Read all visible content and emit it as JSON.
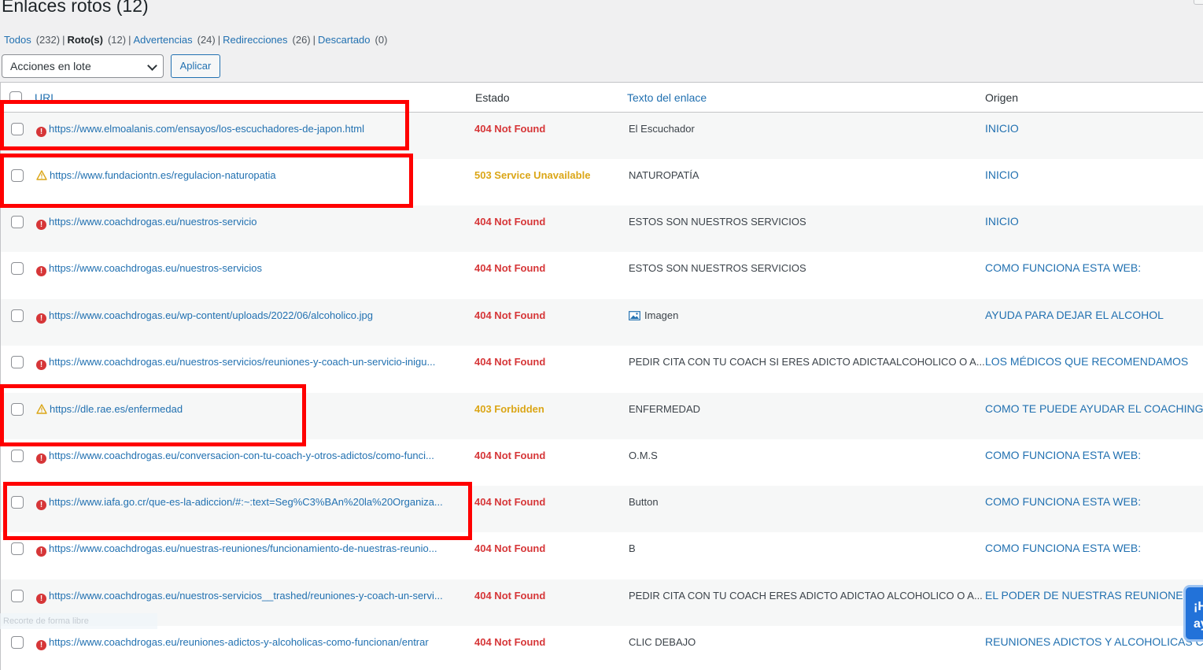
{
  "header": {
    "title": "Enlaces rotos (12)"
  },
  "filters": [
    {
      "label": "Todos",
      "count": "(232)",
      "current": false
    },
    {
      "label": "Roto(s)",
      "count": "(12)",
      "current": true
    },
    {
      "label": "Advertencias",
      "count": "(24)",
      "current": false
    },
    {
      "label": "Redirecciones",
      "count": "(26)",
      "current": false
    },
    {
      "label": "Descartado",
      "count": "(0)",
      "current": false
    }
  ],
  "bulk": {
    "select_value": "Acciones en lote",
    "apply_label": "Aplicar"
  },
  "table": {
    "columns": {
      "url": "URL",
      "estado": "Estado",
      "texto": "Texto del enlace",
      "origen": "Origen"
    },
    "rows": [
      {
        "icon": "error-icon",
        "url": "https://www.elmoalanis.com/ensayos/los-escuchadores-de-japon.html",
        "estado": "404 Not Found",
        "estado_type": "error",
        "texto": "El Escuchador",
        "texto_icon": "",
        "origen": "INICIO"
      },
      {
        "icon": "warning-icon",
        "url": "https://www.fundaciontn.es/regulacion-naturopatia",
        "estado": "503 Service Unavailable",
        "estado_type": "warning",
        "texto": "NATUROPATÍA",
        "texto_icon": "",
        "origen": "INICIO"
      },
      {
        "icon": "error-icon",
        "url": "https://www.coachdrogas.eu/nuestros-servicio",
        "estado": "404 Not Found",
        "estado_type": "error",
        "texto": "ESTOS SON NUESTROS SERVICIOS",
        "texto_icon": "",
        "origen": "INICIO"
      },
      {
        "icon": "error-icon",
        "url": "https://www.coachdrogas.eu/nuestros-servicios",
        "estado": "404 Not Found",
        "estado_type": "error",
        "texto": "ESTOS SON NUESTROS SERVICIOS",
        "texto_icon": "",
        "origen": "COMO FUNCIONA ESTA WEB:"
      },
      {
        "icon": "error-icon",
        "url": "https://www.coachdrogas.eu/wp-content/uploads/2022/06/alcoholico.jpg",
        "estado": "404 Not Found",
        "estado_type": "error",
        "texto": "Imagen",
        "texto_icon": "image-icon",
        "origen": "AYUDA PARA DEJAR EL ALCOHOL"
      },
      {
        "icon": "error-icon",
        "url": "https://www.coachdrogas.eu/nuestros-servicios/reuniones-y-coach-un-servicio-inigu...",
        "estado": "404 Not Found",
        "estado_type": "error",
        "texto": "PEDIR CITA CON TU COACH SI ERES ADICTO ADICTAALCOHOLICO O A...",
        "texto_icon": "",
        "origen": "LOS MÉDICOS QUE RECOMENDAMOS"
      },
      {
        "icon": "warning-icon",
        "url": "https://dle.rae.es/enfermedad",
        "estado": "403 Forbidden",
        "estado_type": "warning",
        "texto": "ENFERMEDAD",
        "texto_icon": "",
        "origen": "COMO TE PUEDE AYUDAR EL COACHING A"
      },
      {
        "icon": "error-icon",
        "url": "https://www.coachdrogas.eu/conversacion-con-tu-coach-y-otros-adictos/como-funci...",
        "estado": "404 Not Found",
        "estado_type": "error",
        "texto": "O.M.S",
        "texto_icon": "",
        "origen": "COMO FUNCIONA ESTA WEB:"
      },
      {
        "icon": "error-icon",
        "url": "https://www.iafa.go.cr/que-es-la-adiccion/#:~:text=Seg%C3%BAn%20la%20Organiza...",
        "estado": "404 Not Found",
        "estado_type": "error",
        "texto": "Button",
        "texto_icon": "",
        "origen": "COMO FUNCIONA ESTA WEB:"
      },
      {
        "icon": "error-icon",
        "url": "https://www.coachdrogas.eu/nuestras-reuniones/funcionamiento-de-nuestras-reunio...",
        "estado": "404 Not Found",
        "estado_type": "error",
        "texto": "B",
        "texto_icon": "",
        "origen": "COMO FUNCIONA ESTA WEB:"
      },
      {
        "icon": "error-icon",
        "url": "https://www.coachdrogas.eu/nuestros-servicios__trashed/reuniones-y-coach-un-servi...",
        "estado": "404 Not Found",
        "estado_type": "error",
        "texto": "PEDIR CITA CON TU COACH ERES ADICTO ADICTAO ALCOHOLICO O A...",
        "texto_icon": "",
        "origen": "EL PODER DE NUESTRAS REUNIONES"
      },
      {
        "icon": "error-icon",
        "url": "https://www.coachdrogas.eu/reuniones-adictos-y-alcoholicas-como-funcionan/entrar",
        "estado": "404 Not Found",
        "estado_type": "error",
        "texto": "CLIC DEBAJO",
        "texto_icon": "",
        "origen": "REUNIONES ADICTOS Y ALCOHOLICAS C"
      }
    ]
  },
  "watermark": "Recorte de forma libre",
  "chat": {
    "label_line1": "¡H",
    "label_line2": "ay"
  },
  "colors": {
    "link": "#2271b1",
    "error": "#d63638",
    "warning": "#dba617",
    "highlight": "#ff0000"
  }
}
